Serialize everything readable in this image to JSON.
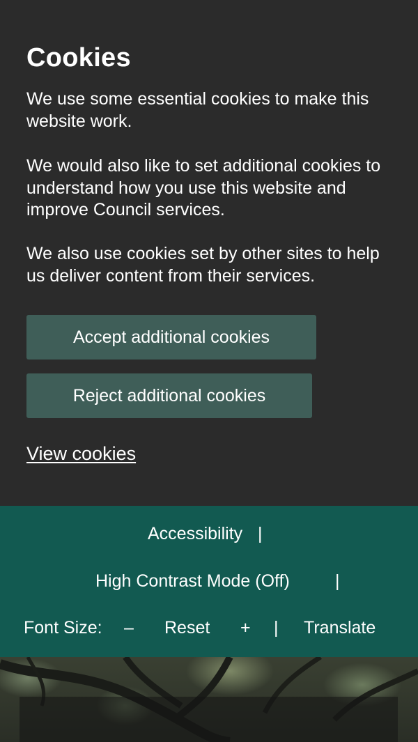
{
  "cookies": {
    "title": "Cookies",
    "paragraphs": [
      "We use some essential cookies to make this website work.",
      "We would also like to set additional cookies to understand how you use this website and improve Council services.",
      "We also use cookies set by other sites to help us deliver content from their services."
    ],
    "accept_label": "Accept additional cookies",
    "reject_label": "Reject additional cookies",
    "view_label": "View cookies"
  },
  "accessibility_bar": {
    "accessibility_label": "Accessibility",
    "separator": "|",
    "contrast_label": "High Contrast Mode (Off)",
    "font_size_label": "Font Size:",
    "decrease_label": "–",
    "reset_label": "Reset",
    "increase_label": "+",
    "translate_label": "Translate"
  },
  "colors": {
    "banner_bg": "#2b2b2b",
    "button_bg": "#3f5e58",
    "accessibility_bar_bg": "#125a51",
    "text": "#ffffff"
  }
}
